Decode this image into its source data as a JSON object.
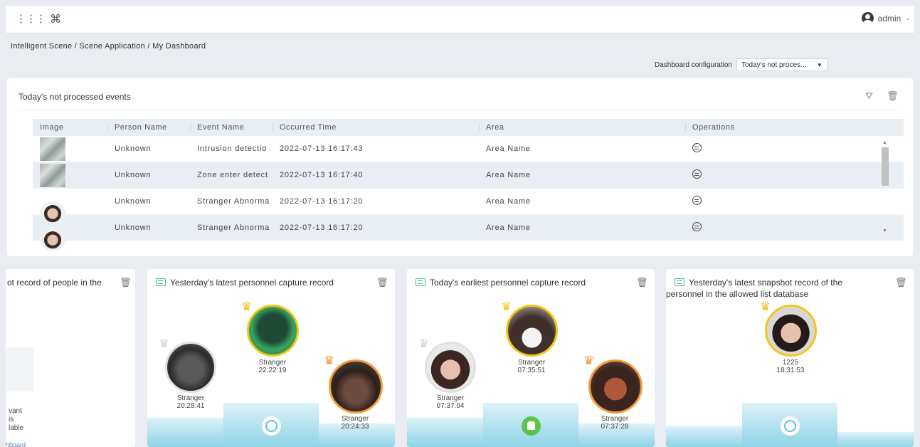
{
  "topbar": {
    "user": "admin"
  },
  "breadcrumb": "Intelligent Scene / Scene Application / My Dashboard",
  "dash_config": {
    "label": "Dashboard configuration",
    "value": "Today's not proces..."
  },
  "events_panel": {
    "title": "Today's not processed events",
    "columns": [
      "Image",
      "Person Name",
      "Event Name",
      "Occurred Time",
      "Area",
      "Operations"
    ],
    "rows": [
      {
        "image": "street-thumbnail",
        "person": "Unknown",
        "event": "Intrusion detectio",
        "time": "2022-07-13 16:17:43",
        "area": "Area Name"
      },
      {
        "image": "street-thumbnail",
        "person": "Unknown",
        "event": "Zone enter detect",
        "time": "2022-07-13 16:17:40",
        "area": "Area Name"
      },
      {
        "image": "face-thumbnail",
        "person": "Unknown",
        "event": "Stranger Abnorma",
        "time": "2022-07-13 16:17:20",
        "area": "Area Name"
      },
      {
        "image": "face-thumbnail",
        "person": "Unknown",
        "event": "Stranger Abnorma",
        "time": "2022-07-13 16:17:20",
        "area": "Area Name"
      }
    ]
  },
  "cards": [
    {
      "title": "ot record of people in the",
      "empty_text": [
        "vant",
        "is",
        "lable"
      ],
      "footer": "hboard"
    },
    {
      "title": "Yesterday's latest personnel capture record",
      "first": {
        "name": "Stranger",
        "time": "22:22:19"
      },
      "second": {
        "name": "Stranger",
        "time": "20:28:41"
      },
      "third": {
        "name": "Stranger",
        "time": "20:24:33"
      },
      "podium_icon": "alarm-clock-icon"
    },
    {
      "title": "Today's earliest personnel capture record",
      "first": {
        "name": "Stranger",
        "time": "07:35:51"
      },
      "second": {
        "name": "Stranger",
        "time": "07:37:04"
      },
      "third": {
        "name": "Stranger",
        "time": "07:37:28"
      },
      "podium_icon": "thumbs-up-icon"
    },
    {
      "title": "Yesterday's latest snapshot record of the personnel in the allowed list database",
      "first": {
        "name": "1225",
        "time": "18:31:53"
      },
      "podium_icon": "alarm-clock-icon"
    }
  ],
  "colors": {
    "accent_green": "#38c08a",
    "podium_blue": "#8fd4e6",
    "crown_gold": "#f6c31a",
    "crown_orange": "#f19a3b"
  }
}
